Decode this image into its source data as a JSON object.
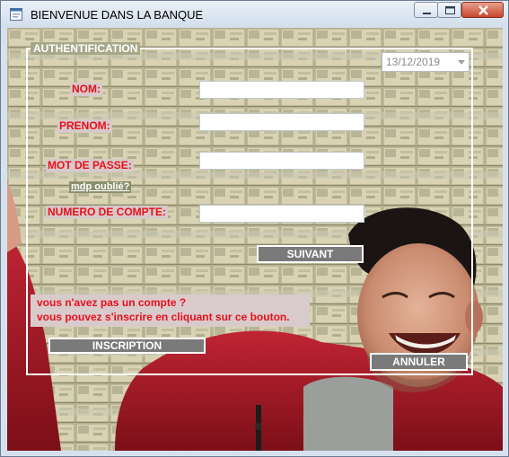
{
  "window": {
    "title": "BIENVENUE DANS LA BANQUE"
  },
  "form": {
    "group_title": "AUTHENTIFICATION",
    "date_value": "13/12/2019",
    "labels": {
      "nom": "NOM:",
      "prenom": "PRENOM:",
      "mot_de_passe": "MOT DE PASSE:",
      "numero_de_compte": "NUMERO DE COMPTE:"
    },
    "forgot_link": "mdp oublié?",
    "inputs": {
      "nom": "",
      "prenom": "",
      "mot_de_passe": "",
      "numero_de_compte": ""
    },
    "next_button": "SUIVANT",
    "no_account_line1": "vous n'avez pas un compte ?",
    "no_account_line2": "vous pouvez s'inscrire en cliquant sur ce bouton.",
    "register_button": "INSCRIPTION",
    "cancel_button": "ANNULER"
  },
  "colors": {
    "label_red": "#e8101b",
    "button_gray": "#7a7a7a",
    "jumpsuit_red": "#b51f2a"
  },
  "icons": {
    "app": "form-icon",
    "minimize": "minimize-icon",
    "maximize": "maximize-icon",
    "close": "close-icon",
    "date_dropdown": "chevron-down-icon"
  }
}
